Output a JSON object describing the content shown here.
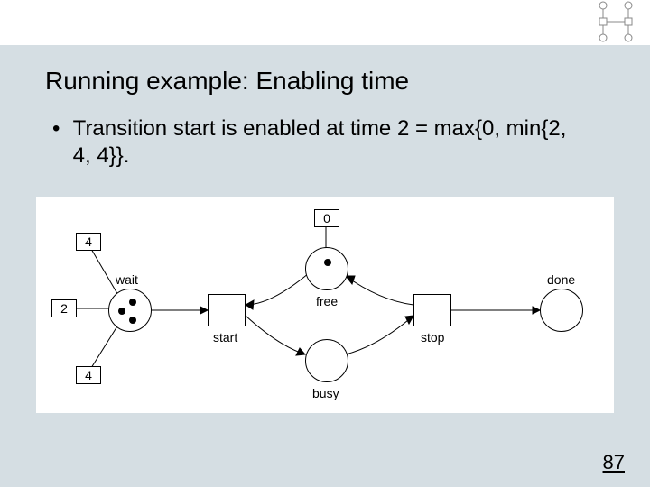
{
  "slide": {
    "title": "Running example: Enabling time",
    "bullet": "Transition start is enabled at time 2 = max{0, min{2, 4, 4}}.",
    "page_number": "87"
  },
  "diagram": {
    "timestamps": {
      "wait_top": "4",
      "wait_left": "2",
      "wait_bottom": "4",
      "free": "0"
    },
    "places": {
      "wait": "wait",
      "free": "free",
      "busy": "busy",
      "done": "done"
    },
    "transitions": {
      "start": "start",
      "stop": "stop"
    }
  }
}
